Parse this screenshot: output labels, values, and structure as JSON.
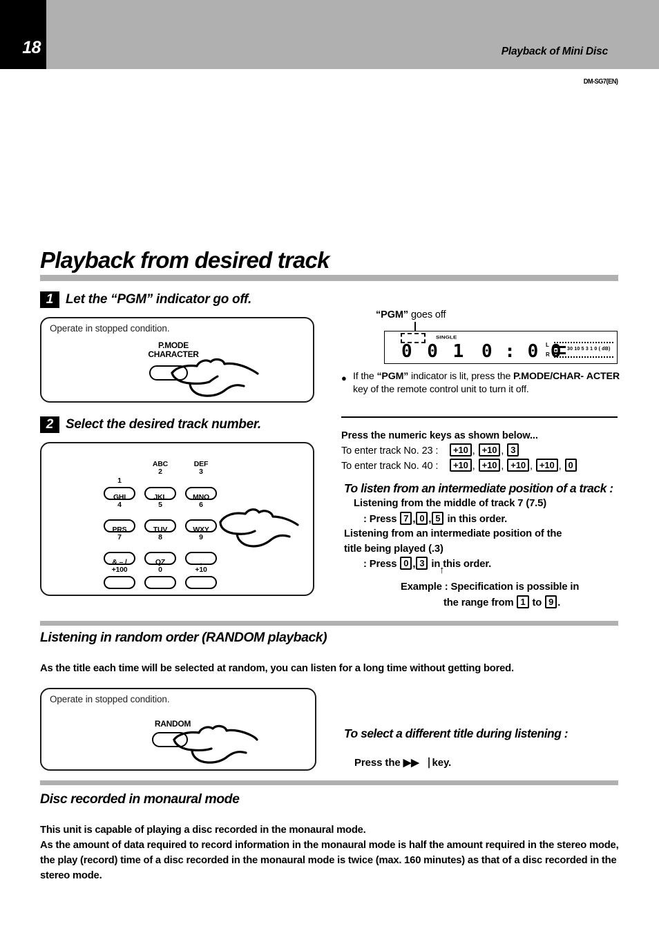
{
  "header": {
    "page_number": "18",
    "title": "Playback of Mini Disc",
    "model_code": "DM-SG7(EN)"
  },
  "main_title": "Playback from desired track",
  "step1": {
    "badge": "1",
    "heading": "Let the “PGM” indicator go off.",
    "panel_caption": "Operate in stopped condition.",
    "button_label": "P.MODE\nCHARACTER"
  },
  "step2": {
    "badge": "2",
    "heading": "Select the desired track number.",
    "keys": [
      {
        "letters": "",
        "digit": "1"
      },
      {
        "letters": "ABC",
        "digit": "2"
      },
      {
        "letters": "DEF",
        "digit": "3"
      },
      {
        "letters": "GHI",
        "digit": "4"
      },
      {
        "letters": "JKL",
        "digit": "5"
      },
      {
        "letters": "MNO",
        "digit": "6"
      },
      {
        "letters": "PRS",
        "digit": "7"
      },
      {
        "letters": "TUV",
        "digit": "8"
      },
      {
        "letters": "WXY",
        "digit": "9"
      },
      {
        "letters": "&    – /",
        "digit": "+100"
      },
      {
        "letters": "QZ",
        "digit": "0"
      },
      {
        "letters": ",",
        "digit": "+10"
      }
    ]
  },
  "display": {
    "callout_quoted": "“PGM”",
    "callout_rest": " goes off",
    "single_label": "SINGLE",
    "track_digits": "0 0 1",
    "time_digits": "0 : 0 0",
    "meter_left_label": "L",
    "meter_right_label": "R",
    "meter_scale": "30  10   5   3   1   0 ( dB)"
  },
  "note": {
    "bullet": "●",
    "line1_a": "If the ",
    "line1_b": "“PGM”",
    "line1_c": " indicator is lit, press the ",
    "line1_d": "P.MODE/CHAR-",
    "line2_a": "ACTER",
    "line2_b": " key of the remote control unit to turn it off."
  },
  "numeric": {
    "header": "Press the numeric keys as shown below...",
    "row1_label": "To enter track No. 23 :",
    "row1_keys": [
      "+10",
      "+10",
      "3"
    ],
    "row2_label": "To enter track No. 40 :",
    "row2_keys": [
      "+10",
      "+10",
      "+10",
      "+10",
      "0"
    ]
  },
  "intermediate": {
    "heading": "To listen from an intermediate position of a track :",
    "line1": "Listening from the middle of track 7 (7.5)",
    "line2_pre": ": Press ",
    "line2_keys": [
      "7",
      "0",
      "5"
    ],
    "line2_post": " in this order.",
    "line3": "Listening from an intermediate position of the",
    "line4": "title being played (.3)",
    "line5_pre": ": Press ",
    "line5_keys": [
      "0",
      "3"
    ],
    "line5_post": " in this order.",
    "arrow": "↑",
    "example_line1": "Example :  Specification is possible in",
    "example_line2_pre": "the range from ",
    "example_key_from": "1",
    "example_mid": " to ",
    "example_key_to": "9",
    "example_line2_post": "."
  },
  "random": {
    "heading": "Listening in random order (RANDOM playback)",
    "paragraph": "As the title each time will be selected at random, you can listen for a long time without getting bored.",
    "panel_caption": "Operate in stopped condition.",
    "button_label": "RANDOM",
    "right_heading": "To select a different title during listening :",
    "right_sub": "Press the ▶▶⎹ key."
  },
  "monaural": {
    "heading": "Disc recorded in monaural mode",
    "paragraph": "This unit is capable of playing a disc recorded in the monaural mode.\nAs the amount of data required to record information in the monaural mode is half the amount required in the stereo mode, the play (record) time of a disc recorded in the monaural mode is twice (max. 160 minutes) as that of a disc recorded in the stereo mode."
  },
  "colors": {
    "band_gray": "#b0b0b0",
    "black": "#000000",
    "white": "#ffffff"
  }
}
